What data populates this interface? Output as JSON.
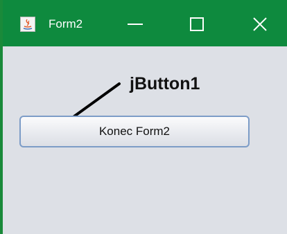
{
  "window": {
    "title": "Form2",
    "titlebar_color": "#0e8a3e",
    "icon": "java-icon",
    "controls": [
      "minimize-icon",
      "maximize-icon",
      "close-icon"
    ]
  },
  "content": {
    "button_label": "Konec Form2",
    "annotation": "jButton1"
  },
  "colors": {
    "content_bg": "#dde0e6",
    "button_border": "#7c9cc7"
  }
}
